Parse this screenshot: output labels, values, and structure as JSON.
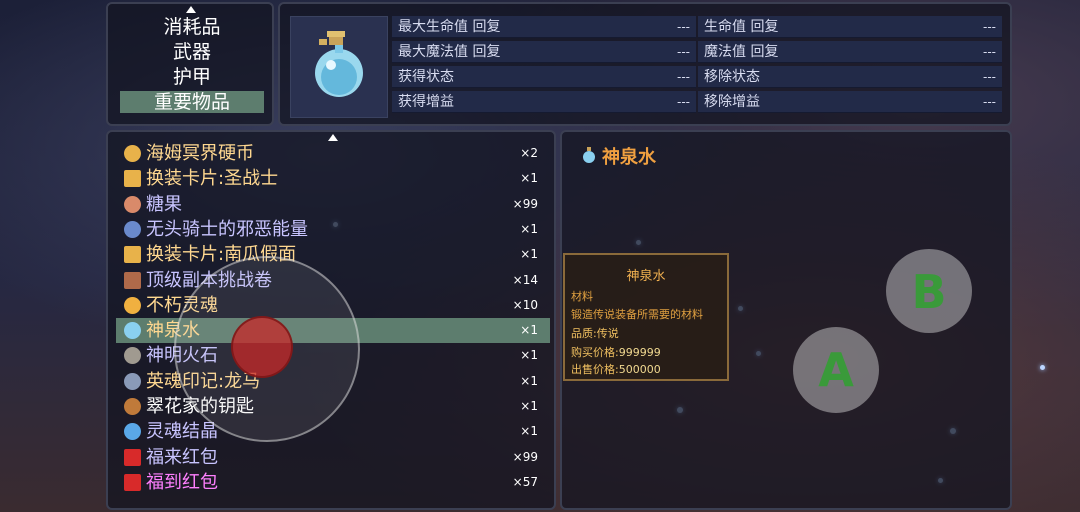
{
  "categories": {
    "items": [
      {
        "label": "消耗品"
      },
      {
        "label": "武器"
      },
      {
        "label": "护甲"
      },
      {
        "label": "重要物品"
      }
    ],
    "selected_index": 3
  },
  "stats": {
    "left": [
      {
        "label": "最大生命值 回复",
        "value": "---"
      },
      {
        "label": "最大魔法值 回复",
        "value": "---"
      },
      {
        "label": "获得状态",
        "value": "---"
      },
      {
        "label": "获得增益",
        "value": "---"
      }
    ],
    "right": [
      {
        "label": "生命值 回复",
        "value": "---"
      },
      {
        "label": "魔法值 回复",
        "value": "---"
      },
      {
        "label": "移除状态",
        "value": "---"
      },
      {
        "label": "移除增益",
        "value": "---"
      }
    ]
  },
  "items": [
    {
      "name": "海姆冥界硬币",
      "count": "×2",
      "color": "#ffd890",
      "icon": "coin-icon",
      "icon_color": "#e8b24a"
    },
    {
      "name": "换装卡片:圣战士",
      "count": "×1",
      "color": "#ffd890",
      "icon": "ticket-icon",
      "icon_color": "#e8b24a"
    },
    {
      "name": "糖果",
      "count": "×99",
      "color": "#c8c4ff",
      "icon": "candy-icon",
      "icon_color": "#d98a6a"
    },
    {
      "name": "无头骑士的邪恶能量",
      "count": "×1",
      "color": "#c8c4ff",
      "icon": "bottle-icon",
      "icon_color": "#6a8acc"
    },
    {
      "name": "换装卡片:南瓜假面",
      "count": "×1",
      "color": "#ffd890",
      "icon": "ticket-icon",
      "icon_color": "#e8b24a"
    },
    {
      "name": "顶级副本挑战卷",
      "count": "×14",
      "color": "#c8c4ff",
      "icon": "scroll-icon",
      "icon_color": "#b06a4a"
    },
    {
      "name": "不朽灵魂",
      "count": "×10",
      "color": "#ffd890",
      "icon": "orb-icon",
      "icon_color": "#f0b040"
    },
    {
      "name": "神泉水",
      "count": "×1",
      "color": "#ffd890",
      "icon": "potion-icon",
      "icon_color": "#8ad0f0"
    },
    {
      "name": "神明火石",
      "count": "×1",
      "color": "#c8c4ff",
      "icon": "stone-icon",
      "icon_color": "#a09a90"
    },
    {
      "name": "英魂印记:龙马",
      "count": "×1",
      "color": "#ffd890",
      "icon": "seal-icon",
      "icon_color": "#8a9ab8"
    },
    {
      "name": "翠花家的钥匙",
      "count": "×1",
      "color": "#ffffff",
      "icon": "key-icon",
      "icon_color": "#c07a3a"
    },
    {
      "name": "灵魂结晶",
      "count": "×1",
      "color": "#c8c4ff",
      "icon": "crystal-icon",
      "icon_color": "#5aa8e8"
    },
    {
      "name": "福来红包",
      "count": "×99",
      "color": "#c8c4ff",
      "icon": "red-envelope-icon",
      "icon_color": "#d82a2a"
    },
    {
      "name": "福到红包",
      "count": "×57",
      "color": "#ff80ff",
      "icon": "red-envelope-icon",
      "icon_color": "#d82a2a"
    }
  ],
  "selected_item_index": 7,
  "detail": {
    "title": "神泉水",
    "title_color": "#f0a040"
  },
  "tooltip": {
    "title": "神泉水",
    "type": "材料",
    "desc": "锻造传说装备所需要的材料",
    "quality_label": "品质:",
    "quality_value": "传说",
    "buy_label": "购买价格:",
    "buy_value": "999999",
    "sell_label": "出售价格:",
    "sell_value": "500000"
  },
  "buttons": {
    "a": "A",
    "b": "B"
  }
}
